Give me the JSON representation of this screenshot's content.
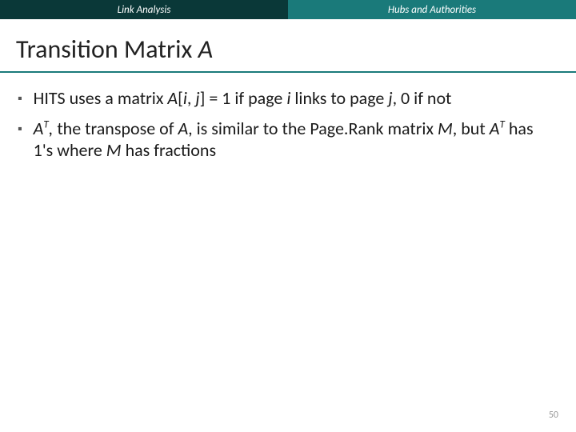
{
  "header": {
    "left": "Link Analysis",
    "right": "Hubs and Authorities"
  },
  "title": {
    "prefix": "Transition Matrix ",
    "var": "A"
  },
  "bullets": [
    {
      "parts": [
        {
          "t": "HITS uses a matrix "
        },
        {
          "t": "A",
          "i": true
        },
        {
          "t": "["
        },
        {
          "t": "i",
          "i": true
        },
        {
          "t": ", "
        },
        {
          "t": "j",
          "i": true
        },
        {
          "t": "] = 1 if page "
        },
        {
          "t": "i",
          "i": true
        },
        {
          "t": " links to page "
        },
        {
          "t": "j",
          "i": true
        },
        {
          "t": ", 0 if not"
        }
      ]
    },
    {
      "parts": [
        {
          "t": "A",
          "i": true
        },
        {
          "t": "T",
          "sup": true
        },
        {
          "t": ", ",
          "i": true
        },
        {
          "t": "the transpose of "
        },
        {
          "t": "A",
          "i": true
        },
        {
          "t": ", is similar to the Page.Rank matrix "
        },
        {
          "t": "M",
          "i": true
        },
        {
          "t": ", but "
        },
        {
          "t": "A",
          "i": true
        },
        {
          "t": "T",
          "sup": true
        },
        {
          "t": " has 1's where "
        },
        {
          "t": "M",
          "i": true
        },
        {
          "t": "  has fractions"
        }
      ]
    }
  ],
  "page_number": "50"
}
